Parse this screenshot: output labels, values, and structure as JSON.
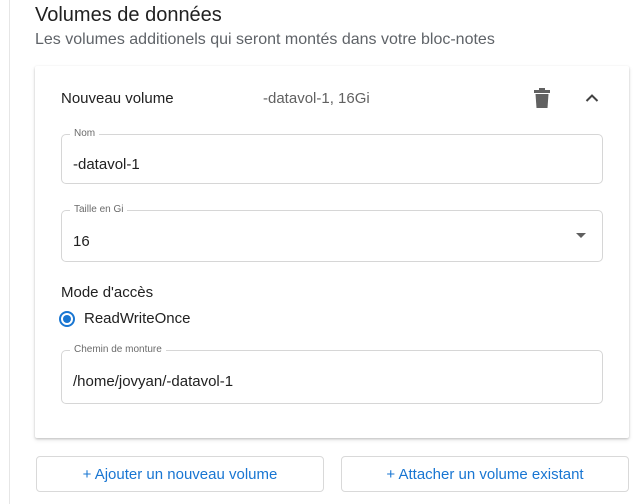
{
  "section": {
    "title": "Volumes de données",
    "subtitle": "Les volumes additionels qui seront montés dans votre bloc-notes"
  },
  "volume": {
    "header_name": "Nouveau volume",
    "header_summary": "-datavol-1, 16Gi",
    "name_field": {
      "label": "Nom",
      "value": "-datavol-1"
    },
    "size_field": {
      "label": "Taille en Gi",
      "value": "16"
    },
    "access_mode": {
      "title": "Mode d'accès",
      "selected_option": "ReadWriteOnce"
    },
    "mount_path_field": {
      "label": "Chemin de monture",
      "value": "/home/jovyan/-datavol-1"
    }
  },
  "actions": {
    "add_new_volume": "+ Ajouter un nouveau volume",
    "attach_existing_volume": "+ Attacher un volume existant"
  },
  "icons": {
    "delete": "trash-icon",
    "collapse": "chevron-up-icon",
    "dropdown": "caret-down-icon"
  },
  "colors": {
    "accent": "#1976d2",
    "text": "#212121",
    "secondary_text": "#5f6368",
    "border": "#d6d6d6"
  }
}
